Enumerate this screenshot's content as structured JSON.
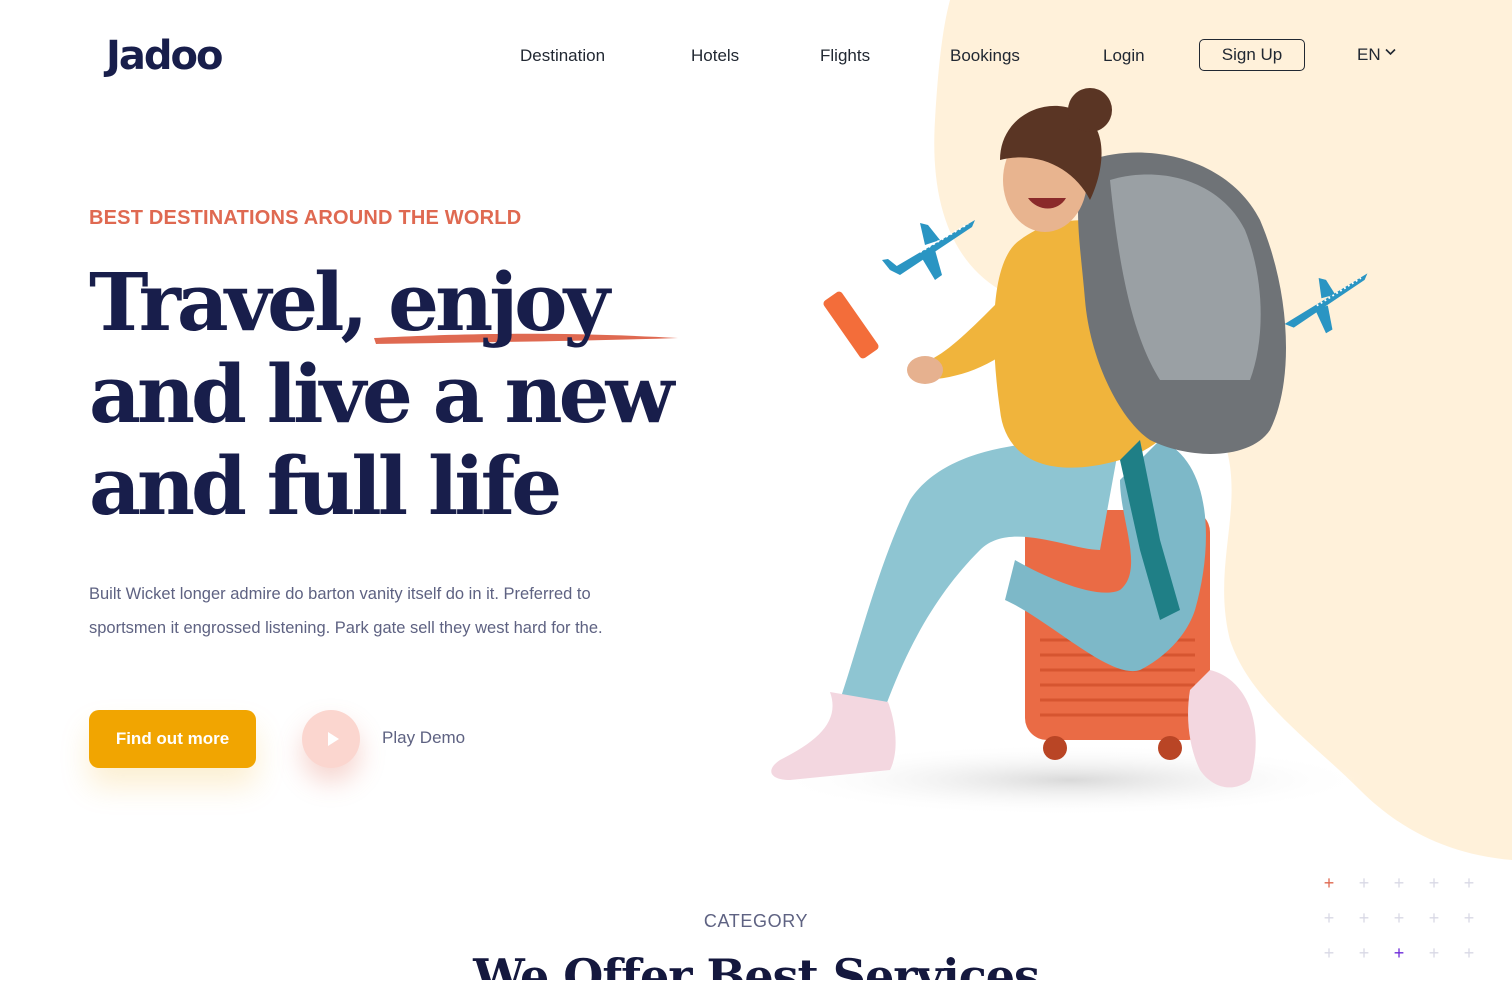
{
  "brand": {
    "logo_text": "Jadoo"
  },
  "nav": {
    "links": [
      "Destination",
      "Hotels",
      "Flights",
      "Bookings",
      "Login"
    ],
    "signup_label": "Sign Up",
    "language": "EN"
  },
  "hero": {
    "eyebrow": "BEST DESTINATIONS AROUND THE WORLD",
    "headline_line1_a": "Travel, ",
    "headline_line1_b": "enjoy",
    "headline_line2": "and live a new",
    "headline_line3": "and full life",
    "description": "Built Wicket longer admire do barton vanity itself do in it. Preferred to sportsmen it engrossed listening. Park gate sell they west hard for the.",
    "cta_label": "Find out more",
    "play_label": "Play Demo"
  },
  "category": {
    "eyebrow": "CATEGORY",
    "title": "We Offer Best Services"
  },
  "colors": {
    "accent_orange": "#df6951",
    "accent_yellow": "#f1a501",
    "heading": "#181e4b",
    "body_text": "#5e6282",
    "blob": "#fff1da"
  }
}
